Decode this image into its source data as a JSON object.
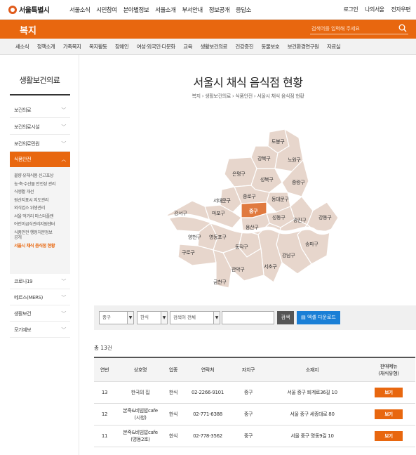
{
  "header": {
    "logo": "서울특별시",
    "gnb": [
      "서울소식",
      "시민참여",
      "분야별정보",
      "서울소개",
      "부서안내",
      "정보공개",
      "응답소"
    ],
    "util": [
      "로그인",
      "나의서울",
      "전자우편"
    ]
  },
  "banner": {
    "title": "복지",
    "search_placeholder": "검색어를 입력해 주세요"
  },
  "subnav": [
    "새소식",
    "정책소개",
    "가족복지",
    "복지활동",
    "장애인",
    "여성·외국인·다문화",
    "교육",
    "생활보건의료",
    "건강증진",
    "동물보호",
    "보건환경연구원",
    "자료실"
  ],
  "lnb": {
    "title": "생활보건의료",
    "items": [
      "보건의료",
      "보건의료시설",
      "보건의료민원",
      "식품안전",
      "코로나19",
      "메르스(MERS)",
      "생활보건",
      "모기예보"
    ],
    "active": "식품안전",
    "sub": [
      "불량·유해식품 신고포상",
      "농·축·수산물 안전성 관리",
      "식생활 개선",
      "원산지표시 지도관리",
      "외식업소 위생관리",
      "서울 먹거리 마스터플랜",
      "어린이급식관리지원센터",
      "식품안전 행정처분정보",
      "공개",
      "서울시 채식 음식점 현황"
    ],
    "sub_active": "서울시 채식 음식점 현황"
  },
  "page": {
    "title": "서울시 채식 음식점 현황",
    "breadcrumb": [
      "복지",
      "생활보건의료",
      "식품안전",
      "서울시 채식 음식점 현황"
    ]
  },
  "map": {
    "districts": [
      "도봉구",
      "강북구",
      "노원구",
      "은평구",
      "성북구",
      "중랑구",
      "종로구",
      "서대문구",
      "동대문구",
      "중구",
      "마포구",
      "성동구",
      "광진구",
      "강동구",
      "강서구",
      "용산구",
      "양천구",
      "영등포구",
      "동작구",
      "송파구",
      "구로구",
      "강남구",
      "서초구",
      "관악구",
      "금천구"
    ],
    "selected": "중구",
    "colors": {
      "base": "#e7d6cc",
      "selected": "#e07a3f",
      "river": "#ffffff",
      "stroke": "#ffffff"
    }
  },
  "filter": {
    "district": "중구",
    "category": "한식",
    "search_type": "검색어 전체",
    "keyword": "",
    "search_label": "검색",
    "excel_label": "엑셀 다운로드"
  },
  "total": "총 13건",
  "table": {
    "headers": [
      "연번",
      "상호명",
      "업종",
      "연락처",
      "자치구",
      "소재지",
      "판매메뉴\n(채식유형)"
    ],
    "rows": [
      {
        "no": "13",
        "name": "한국의 집",
        "type": "한식",
        "tel": "02-2266-9101",
        "gu": "중구",
        "addr": "서울 중구 퇴계로36길 10",
        "btn": "보기"
      },
      {
        "no": "12",
        "name": "본죽&비빔밥cafe\n(시청)",
        "type": "한식",
        "tel": "02-771-6388",
        "gu": "중구",
        "addr": "서울 중구 세종대로 80",
        "btn": "보기"
      },
      {
        "no": "11",
        "name": "본죽&비빔밥cafe\n(명동2호)",
        "type": "한식",
        "tel": "02-778-3562",
        "gu": "중구",
        "addr": "서울 중구 명동9길 10",
        "btn": "보기"
      }
    ]
  }
}
